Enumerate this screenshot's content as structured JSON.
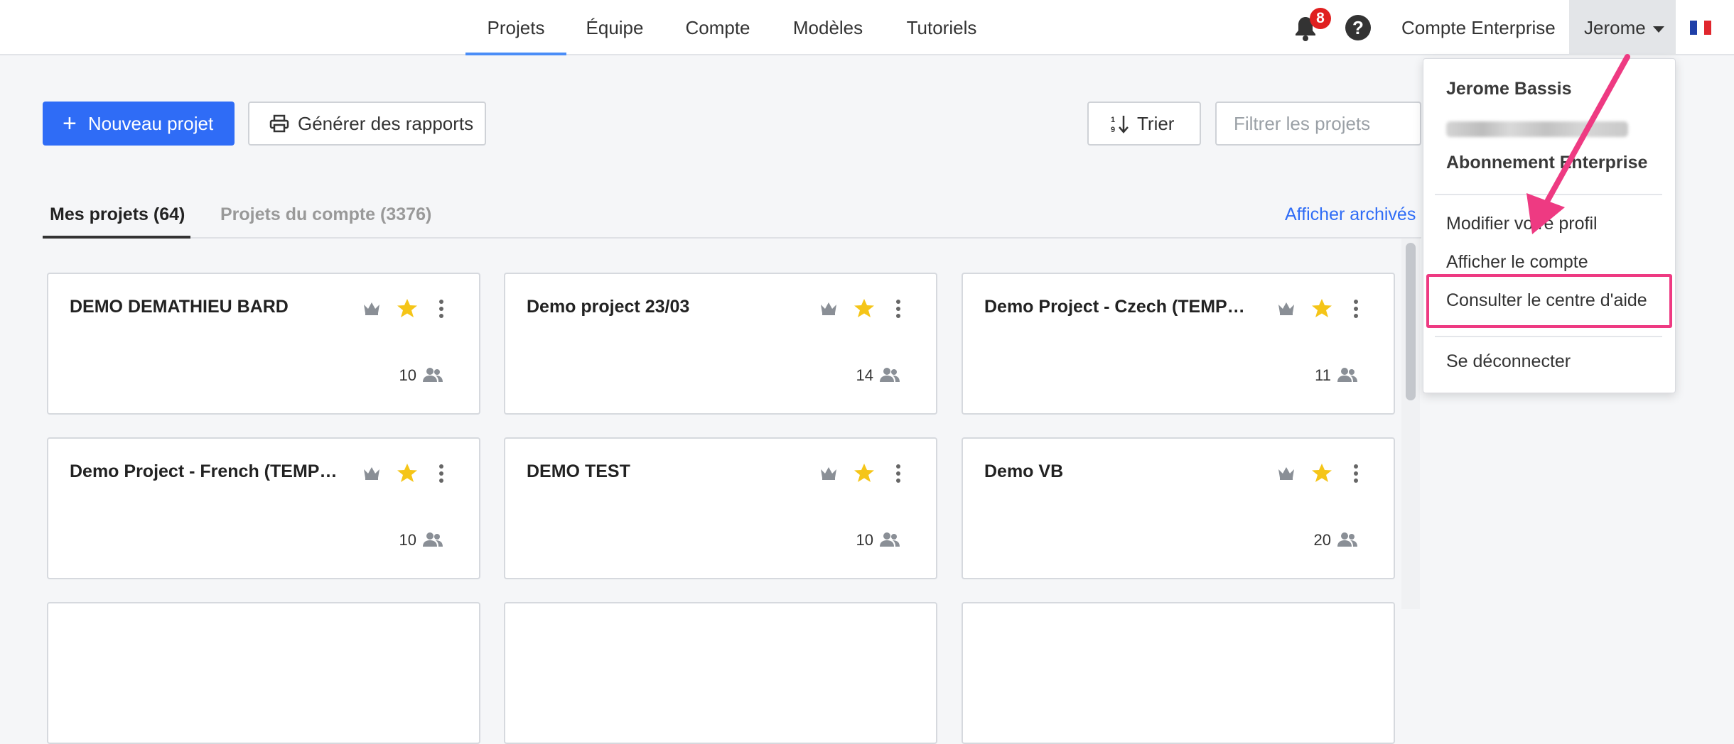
{
  "nav": {
    "tabs": [
      {
        "label": "Projets",
        "active": true
      },
      {
        "label": "Équipe"
      },
      {
        "label": "Compte"
      },
      {
        "label": "Modèles"
      },
      {
        "label": "Tutoriels"
      }
    ],
    "notification_count": "8",
    "help_glyph": "?",
    "account_label": "Compte Enterprise",
    "user_label": "Jerome",
    "language": "fr"
  },
  "toolbar": {
    "new_project": "Nouveau projet",
    "reports": "Générer des rapports",
    "sort": "Trier",
    "filter_placeholder": "Filtrer les projets"
  },
  "tabs": {
    "mine": "Mes projets (64)",
    "account": "Projets du compte (3376)",
    "archived": "Afficher archivés"
  },
  "projects": [
    {
      "title": "DEMO DEMATHIEU BARD",
      "members": "10"
    },
    {
      "title": "Demo project 23/03",
      "members": "14"
    },
    {
      "title": "Demo Project - Czech (TEMPLATE)",
      "members": "11"
    },
    {
      "title": "Demo Project - French (TEMPLATE)",
      "members": "10"
    },
    {
      "title": "DEMO TEST",
      "members": "10"
    },
    {
      "title": "Demo VB",
      "members": "20"
    }
  ],
  "dropdown": {
    "name": "Jerome Bassis",
    "plan": "Abonnement Enterprise",
    "edit_profile": "Modifier votre profil",
    "view_account": "Afficher le compte",
    "help_center": "Consulter le centre d'aide",
    "logout": "Se déconnecter"
  },
  "colors": {
    "primary": "#2f6cf6",
    "star": "#f5c518",
    "annotation": "#ee3a82"
  }
}
